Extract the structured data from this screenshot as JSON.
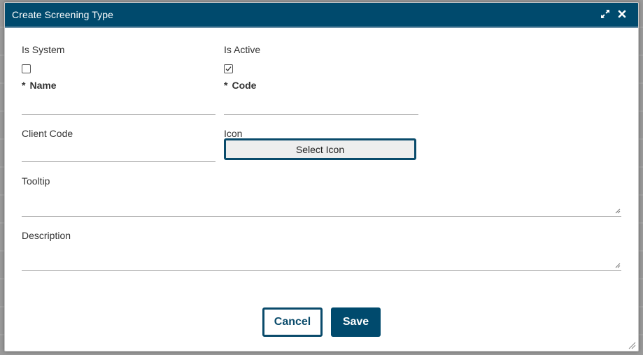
{
  "dialog": {
    "title": "Create Screening Type"
  },
  "titlebar_icons": {
    "maximize": "expand-icon",
    "close": "close-icon"
  },
  "fields": {
    "is_system": {
      "label": "Is System",
      "checked": false
    },
    "is_active": {
      "label": "Is Active",
      "checked": true
    },
    "name": {
      "required_mark": "*",
      "label": "Name",
      "value": ""
    },
    "code": {
      "required_mark": "*",
      "label": "Code",
      "value": ""
    },
    "client_code": {
      "label": "Client Code",
      "value": ""
    },
    "icon": {
      "label": "Icon",
      "button_label": "Select Icon"
    },
    "tooltip": {
      "label": "Tooltip",
      "value": ""
    },
    "description": {
      "label": "Description",
      "value": ""
    }
  },
  "actions": {
    "cancel_label": "Cancel",
    "save_label": "Save"
  },
  "colors": {
    "primary": "#004a6d",
    "primary_border": "#0a4b6b",
    "text": "#333333",
    "field_line": "#9c9c9c"
  }
}
